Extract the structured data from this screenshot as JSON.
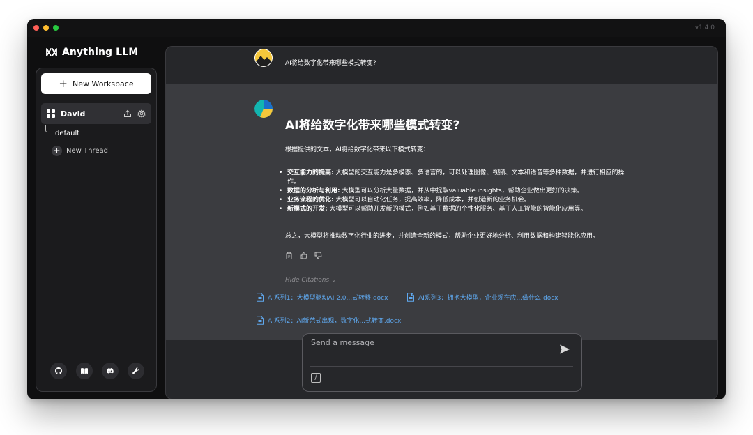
{
  "window": {
    "version": "v1.4.0"
  },
  "app": {
    "name": "Anything LLM"
  },
  "sidebar": {
    "new_workspace_label": "New Workspace",
    "workspace_name": "David",
    "thread_default": "default",
    "new_thread_label": "New Thread"
  },
  "chat": {
    "user_question": "AI将给数字化带来哪些模式转变?",
    "response": {
      "title": "AI将给数字化带来哪些模式转变?",
      "intro": "根据提供的文本，AI将给数字化带来以下模式转变：",
      "bullets": [
        {
          "bold": "交互能力的提高:",
          "text": " 大模型的交互能力是多模态、多语言的，可以处理图像、视频、文本和语音等多种数据，并进行相应的操作。"
        },
        {
          "bold": "数据的分析与利用:",
          "text": " 大模型可以分析大量数据，并从中提取valuable insights，帮助企业做出更好的决策。"
        },
        {
          "bold": "业务流程的优化:",
          "text": " 大模型可以自动化任务，提高效率，降低成本，并创造新的业务机会。"
        },
        {
          "bold": "新模式的开发:",
          "text": " 大模型可以帮助开发新的模式，例如基于数据的个性化服务、基于人工智能的智能化应用等。"
        }
      ],
      "conclusion": "总之，大模型将推动数字化行业的进步，并创造全新的模式，帮助企业更好地分析、利用数据和构建智能化应用。"
    },
    "hide_citations_label": "Hide Citations ⌄",
    "citations": [
      "AI系列1：大模型驱动AI 2.0...式转移.docx",
      "AI系列3：拥抱大模型，企业现在应...做什么.docx",
      "AI系列2：AI新范式出现，数字化...式转变.docx"
    ]
  },
  "composer": {
    "placeholder": "Send a message",
    "slash_label": "/"
  },
  "colors": {
    "link": "#5fa8ee",
    "accent_yellow": "#f6c83b",
    "accent_teal": "#12b5b0"
  }
}
